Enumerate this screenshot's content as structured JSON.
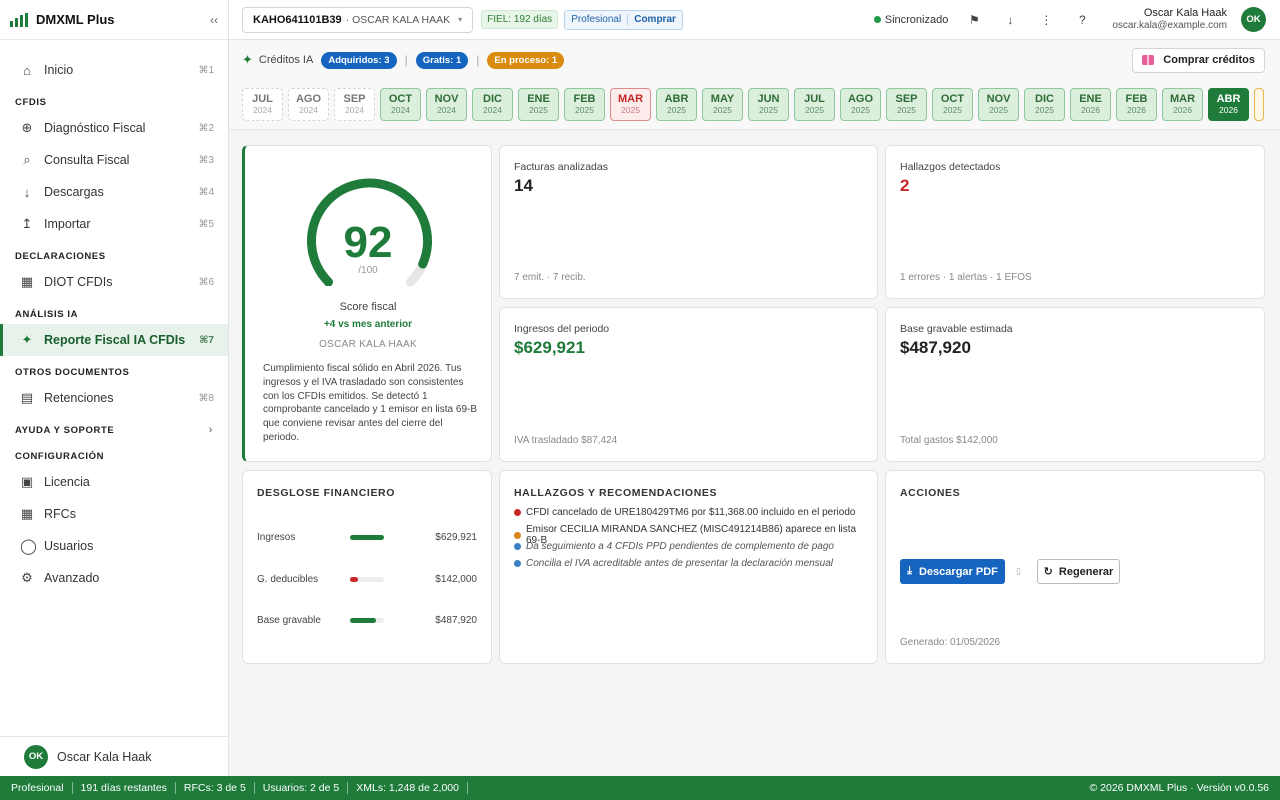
{
  "app": {
    "name": "DMXML Plus",
    "collapse_icon": "‹‹"
  },
  "sidebar": {
    "items": [
      {
        "label": "Inicio",
        "kbd": "⌘1",
        "icon": "home-icon"
      },
      {
        "section": "CFDIS"
      },
      {
        "label": "Diagnóstico Fiscal",
        "kbd": "⌘2",
        "icon": "plus-circle-icon"
      },
      {
        "label": "Consulta Fiscal",
        "kbd": "⌘3",
        "icon": "search-icon"
      },
      {
        "label": "Descargas",
        "kbd": "⌘4",
        "icon": "download-icon"
      },
      {
        "label": "Importar",
        "kbd": "⌘5",
        "icon": "import-icon"
      },
      {
        "section": "DECLARACIONES"
      },
      {
        "label": "DIOT CFDIs",
        "kbd": "⌘6",
        "icon": "grid-icon"
      },
      {
        "section": "ANÁLISIS IA"
      },
      {
        "label": "Reporte Fiscal IA CFDIs",
        "kbd": "⌘7",
        "icon": "sparkle-icon",
        "active": true
      },
      {
        "section": "OTROS DOCUMENTOS"
      },
      {
        "label": "Retenciones",
        "kbd": "⌘8",
        "icon": "list-icon"
      },
      {
        "section": "AYUDA Y SOPORTE",
        "chevron": "›"
      },
      {
        "section": "CONFIGURACIÓN"
      },
      {
        "label": "Licencia",
        "icon": "license-icon"
      },
      {
        "label": "RFCs",
        "icon": "grid-icon"
      },
      {
        "label": "Usuarios",
        "icon": "users-icon"
      },
      {
        "label": "Avanzado",
        "icon": "gear-icon"
      }
    ],
    "user": {
      "initials": "OK",
      "name": "Oscar Kala Haak"
    }
  },
  "topbar": {
    "rfc": "KAHO641101B39",
    "rfc_name": "· OSCAR KALA HAAK",
    "rfc_caret": "▾",
    "fiel": "FIEL: 192 días",
    "plan": "Profesional",
    "plan_buy": "Comprar",
    "sync": "Sincronizado",
    "icons": [
      {
        "name": "flag-icon",
        "glyph": "⚑"
      },
      {
        "name": "download-icon",
        "glyph": "↓"
      },
      {
        "name": "more-icon",
        "glyph": "⋮"
      },
      {
        "name": "help-icon",
        "glyph": "?"
      }
    ],
    "user_name": "Oscar Kala Haak",
    "user_email": "oscar.kala@example.com",
    "user_initials": "OK"
  },
  "credits": {
    "label": "Créditos IA",
    "acquired": "Adquiridos: 3",
    "free": "Gratis: 1",
    "in_process": "En proceso: 1",
    "buy": "Comprar créditos"
  },
  "months": [
    {
      "m": "JUL",
      "y": "2024",
      "state": "empty"
    },
    {
      "m": "AGO",
      "y": "2024",
      "state": "empty"
    },
    {
      "m": "SEP",
      "y": "2024",
      "state": "empty"
    },
    {
      "m": "OCT",
      "y": "2024",
      "state": "ok"
    },
    {
      "m": "NOV",
      "y": "2024",
      "state": "ok"
    },
    {
      "m": "DIC",
      "y": "2024",
      "state": "ok"
    },
    {
      "m": "ENE",
      "y": "2025",
      "state": "ok"
    },
    {
      "m": "FEB",
      "y": "2025",
      "state": "ok"
    },
    {
      "m": "MAR",
      "y": "2025",
      "state": "bad"
    },
    {
      "m": "ABR",
      "y": "2025",
      "state": "ok"
    },
    {
      "m": "MAY",
      "y": "2025",
      "state": "ok"
    },
    {
      "m": "JUN",
      "y": "2025",
      "state": "ok"
    },
    {
      "m": "JUL",
      "y": "2025",
      "state": "ok"
    },
    {
      "m": "AGO",
      "y": "2025",
      "state": "ok"
    },
    {
      "m": "SEP",
      "y": "2025",
      "state": "ok"
    },
    {
      "m": "OCT",
      "y": "2025",
      "state": "ok"
    },
    {
      "m": "NOV",
      "y": "2025",
      "state": "ok"
    },
    {
      "m": "DIC",
      "y": "2025",
      "state": "ok"
    },
    {
      "m": "ENE",
      "y": "2026",
      "state": "ok"
    },
    {
      "m": "FEB",
      "y": "2026",
      "state": "ok"
    },
    {
      "m": "MAR",
      "y": "2026",
      "state": "ok"
    },
    {
      "m": "ABR",
      "y": "2026",
      "state": "sel"
    }
  ],
  "score": {
    "value": "92",
    "max": "/100",
    "fraction": 0.92,
    "label": "Score fiscal",
    "delta": "+4 vs mes anterior",
    "name": "OSCAR KALA HAAK",
    "description": "Cumplimiento fiscal sólido en Abril 2026. Tus ingresos y el IVA trasladado son consistentes con los CFDIs emitidos. Se detectó 1 comprobante cancelado y 1 emisor en lista 69-B que conviene revisar antes del cierre del periodo."
  },
  "stats": {
    "facturas": {
      "title": "Facturas analizadas",
      "value": "14",
      "foot": "7 emit. · 7 recib."
    },
    "hallazgos": {
      "title": "Hallazgos detectados",
      "value": "2",
      "foot": "1 errores · 1 alertas · 1 EFOS"
    },
    "ingresos": {
      "title": "Ingresos del periodo",
      "value": "$629,921",
      "foot": "IVA trasladado $87,424"
    },
    "base": {
      "title": "Base gravable estimada",
      "value": "$487,920",
      "foot": "Total gastos $142,000"
    }
  },
  "breakdown": {
    "title": "DESGLOSE FINANCIERO",
    "rows": [
      {
        "label": "Ingresos",
        "amount": "$629,921",
        "fraction": 1.0,
        "color": "#1e7b3a"
      },
      {
        "label": "G. deducibles",
        "amount": "$142,000",
        "fraction": 0.23,
        "color": "#c62828"
      },
      {
        "label": "Base gravable",
        "amount": "$487,920",
        "fraction": 0.77,
        "color": "#1e7b3a"
      }
    ]
  },
  "findings": {
    "title": "HALLAZGOS Y RECOMENDACIONES",
    "items": [
      {
        "text": "CFDI cancelado de URE180429TM6 por $11,368.00 incluido en el periodo",
        "color": "#c62828",
        "italic": false
      },
      {
        "text": "Emisor CECILIA MIRANDA SANCHEZ (MISC491214B86) aparece en lista 69-B",
        "color": "#d9831a",
        "italic": false
      },
      {
        "text": "Da seguimiento a 4 CFDIs PPD pendientes de complemento de pago",
        "color": "#3b7fc4",
        "italic": true
      },
      {
        "text": "Concilia el IVA acreditable antes de presentar la declaración mensual",
        "color": "#3b7fc4",
        "italic": true
      }
    ]
  },
  "actions": {
    "title": "ACCIONES",
    "pdf": "Descargar PDF",
    "sep": "▯",
    "regen": "Regenerar",
    "generated": "Generado: 01/05/2026"
  },
  "statusbar": {
    "items": [
      "Profesional",
      "191 días restantes",
      "RFCs: 3 de 5",
      "Usuarios: 2 de 5",
      "XMLs: 1,248 de 2,000"
    ],
    "right": "© 2026 DMXML Plus · Versión v0.0.56"
  },
  "colors": {
    "accent": "#1e7b3a",
    "blue": "#1565c0",
    "orange": "#d98c10",
    "red": "#c62828"
  }
}
